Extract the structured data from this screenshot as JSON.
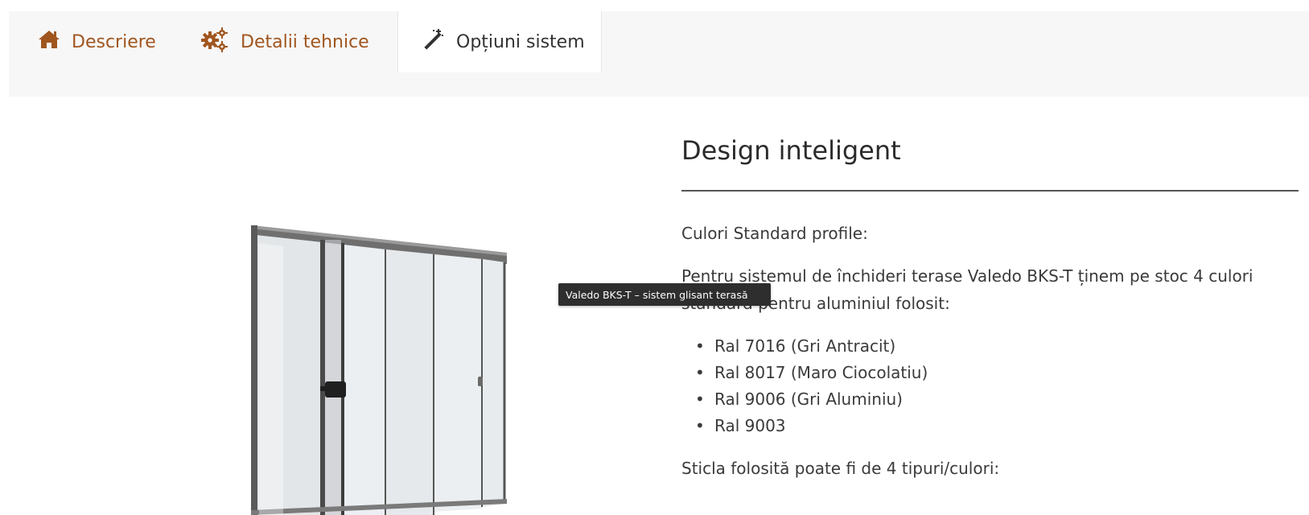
{
  "tabs": [
    {
      "label": "Descriere",
      "icon": "home-icon",
      "active": false
    },
    {
      "label": "Detalii tehnice",
      "icon": "gears-icon",
      "active": false
    },
    {
      "label": "Opțiuni sistem",
      "icon": "magic-wand-icon",
      "active": true
    }
  ],
  "colors": {
    "tab_accent": "#a0561f",
    "tab_bar_bg": "#f7f7f7",
    "tooltip_bg": "#2e2e2e"
  },
  "tooltip": "Valedo BKS-T – sistem glisant terasă",
  "content": {
    "heading": "Design inteligent",
    "paragraph1": "Culori Standard profile:",
    "paragraph2": "Pentru sistemul de închideri terase Valedo BKS-T ținem pe stoc 4 culori standard pentru aluminiul folosit:",
    "list": [
      "Ral 7016 (Gri Antracit)",
      "Ral 8017 (Maro Ciocolatiu)",
      "Ral 9006 (Gri Aluminiu)",
      "Ral 9003"
    ],
    "paragraph3": "Sticla folosită poate fi de 4 tipuri/culori:"
  }
}
